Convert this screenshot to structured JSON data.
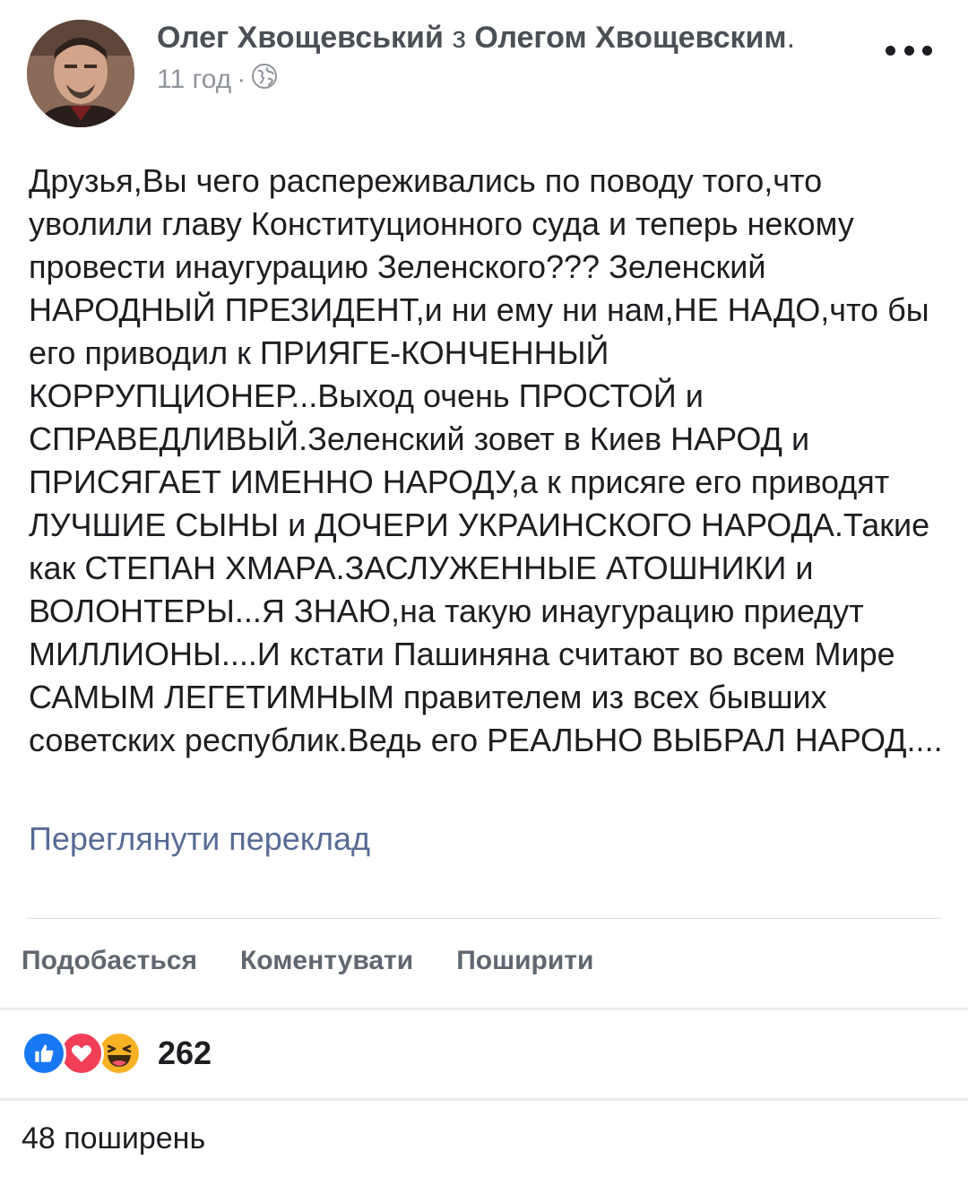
{
  "header": {
    "author_name": "Олег Хвощевський",
    "connector": "з",
    "with_name": "Олегом Хвощевским",
    "end_punct": ".",
    "time": "11 год",
    "separator": "·",
    "privacy_icon": "globe-icon",
    "more_icon": "more-horizontal-icon"
  },
  "post": {
    "text": "Друзья,Вы чего распереживались по поводу того,что уволили главу Конституционного суда и теперь некому провести инаугурацию Зеленского??? Зеленский НАРОДНЫЙ ПРЕЗИДЕНТ,и ни ему ни нам,НЕ НАДО,что бы его приводил к ПРИЯГЕ-КОНЧЕННЫЙ КОРРУПЦИОНЕР...Выход очень ПРОСТОЙ и СПРАВЕДЛИВЫЙ.Зеленский зовет в Киев НАРОД и ПРИСЯГАЕТ ИМЕННО НАРОДУ,а к присяге его приводят ЛУЧШИЕ СЫНЫ и ДОЧЕРИ УКРАИНСКОГО НАРОДА.Такие как СТЕПАН ХМАРА.ЗАСЛУЖЕННЫЕ АТОШНИКИ и ВОЛОНТЕРЫ...Я ЗНАЮ,на такую инаугурацию приедут МИЛЛИОНЫ....И кстати Пашиняна считают во всем Мире САМЫМ ЛЕГЕТИМНЫМ правителем из всех бывших советских республик.Ведь его РЕАЛЬНО ВЫБРАЛ НАРОД....",
    "translate_label": "Переглянути переклад"
  },
  "actions": {
    "like": "Подобається",
    "comment": "Коментувати",
    "share": "Поширити"
  },
  "reactions": {
    "icons": [
      "like-icon",
      "love-icon",
      "haha-icon"
    ],
    "count": "262"
  },
  "shares": {
    "label": "48 поширень"
  },
  "colors": {
    "like": "#1877f2",
    "love": "#f33e58",
    "haha": "#f7b125",
    "link": "#576b95",
    "secondary_text": "#90949c"
  }
}
